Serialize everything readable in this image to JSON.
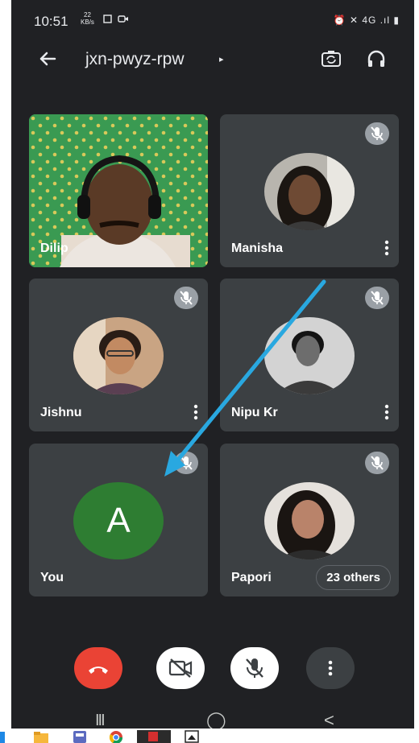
{
  "status_bar": {
    "time": "10:51",
    "speed_value": "22",
    "speed_unit": "KB/s",
    "right_icons": "⏰ ✕ 4G .ıl ▮"
  },
  "app_bar": {
    "meeting_code": "jxn-pwyz-rpw",
    "caret": "▸"
  },
  "participants": [
    {
      "name": "Dilip",
      "muted": false,
      "kind": "video"
    },
    {
      "name": "Manisha",
      "muted": true,
      "kind": "photo"
    },
    {
      "name": "Jishnu",
      "muted": true,
      "kind": "photo"
    },
    {
      "name": "Nipu Kr",
      "muted": true,
      "kind": "photo"
    },
    {
      "name": "You",
      "muted": true,
      "kind": "initial",
      "initial": "A"
    },
    {
      "name": "Papori",
      "muted": true,
      "kind": "photo"
    }
  ],
  "others_chip": "23 others",
  "controls": {
    "end_call_color": "#ea4335",
    "avatar_color": "#2e7d32",
    "annotation_arrow_color": "#29a8e0"
  },
  "nav_bar": {
    "recents": "III",
    "home": "◯",
    "back": "<"
  }
}
